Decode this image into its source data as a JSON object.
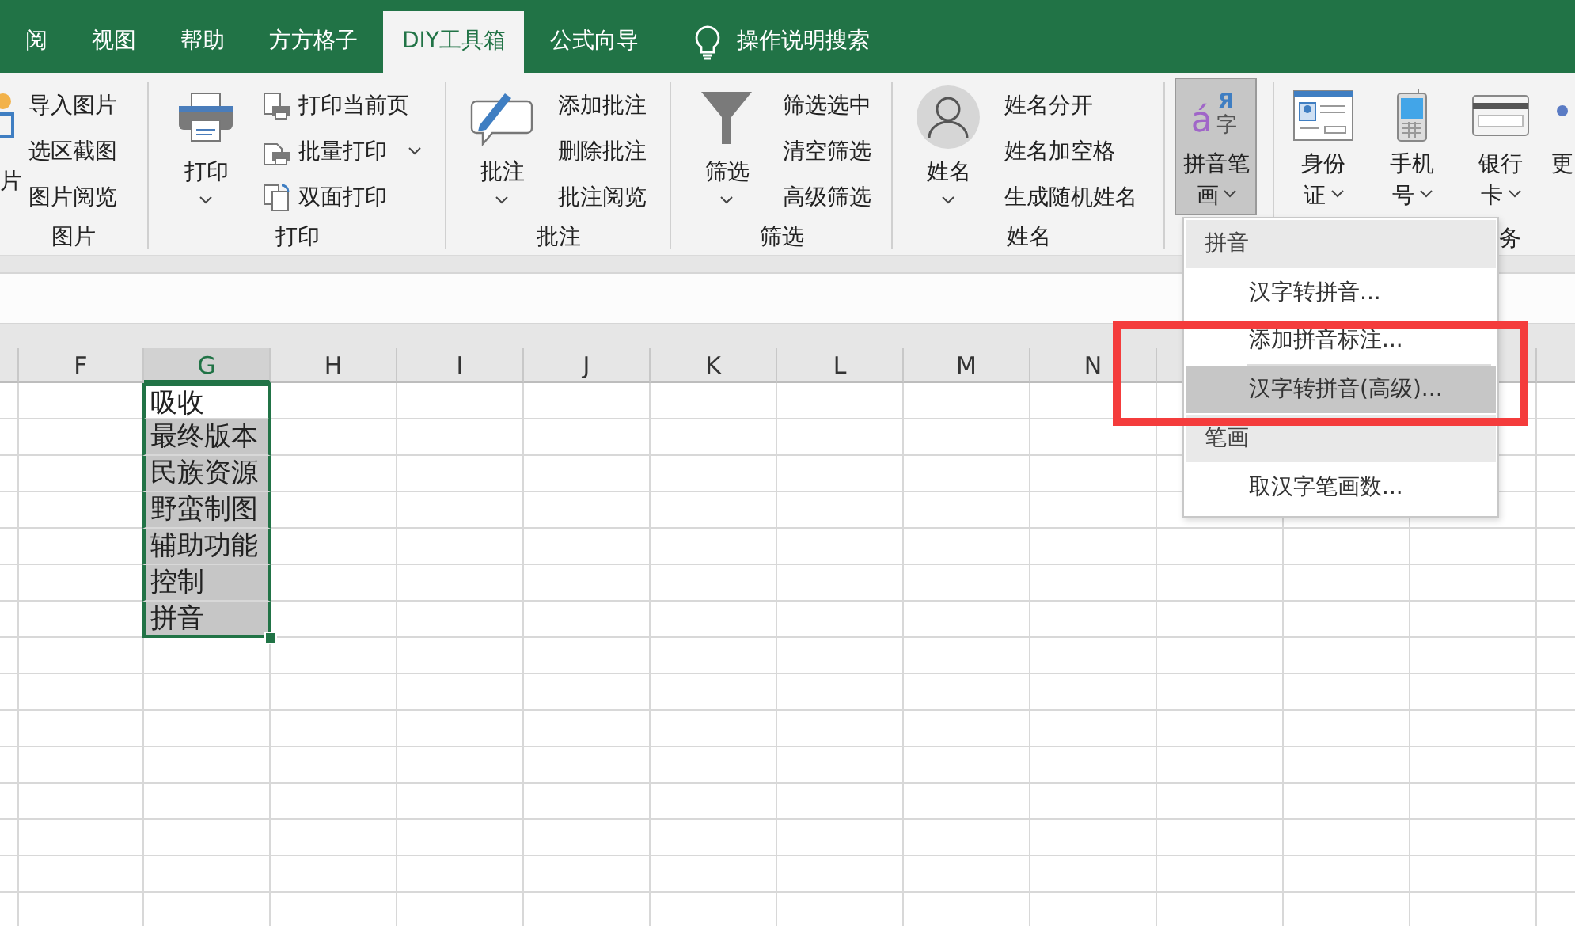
{
  "tabs": [
    {
      "label": "阅",
      "selected": false
    },
    {
      "label": "视图",
      "selected": false
    },
    {
      "label": "帮助",
      "selected": false
    },
    {
      "label": "方方格子",
      "selected": false
    },
    {
      "label": "DIY工具箱",
      "selected": true
    },
    {
      "label": "公式向导",
      "selected": false
    }
  ],
  "tell_me": {
    "label": "操作说明搜索"
  },
  "ribbon_groups": [
    {
      "kind": "list",
      "label": "图片",
      "big": {
        "kind": "picture-cut",
        "label": "片",
        "dropdown": false
      },
      "items": [
        {
          "label": "导入图片",
          "dropdown": false
        },
        {
          "label": "选区截图",
          "dropdown": false
        },
        {
          "label": "图片阅览",
          "dropdown": false
        }
      ]
    },
    {
      "kind": "list",
      "label": "打印",
      "big": {
        "kind": "printer",
        "label": "打印",
        "dropdown": true
      },
      "items": [
        {
          "label": "打印当前页",
          "dropdown": false,
          "kind": "page"
        },
        {
          "label": "批量打印",
          "dropdown": true,
          "kind": "batch"
        },
        {
          "label": "双面打印",
          "dropdown": false,
          "kind": "duplex"
        }
      ]
    },
    {
      "kind": "list",
      "label": "批注",
      "big": {
        "kind": "comment",
        "label": "批注",
        "dropdown": true
      },
      "items": [
        {
          "label": "添加批注",
          "dropdown": false
        },
        {
          "label": "删除批注",
          "dropdown": false
        },
        {
          "label": "批注阅览",
          "dropdown": false
        }
      ]
    },
    {
      "kind": "list",
      "label": "筛选",
      "big": {
        "kind": "filter",
        "label": "筛选",
        "dropdown": true
      },
      "items": [
        {
          "label": "筛选选中",
          "dropdown": false
        },
        {
          "label": "清空筛选",
          "dropdown": false
        },
        {
          "label": "高级筛选",
          "dropdown": false
        }
      ]
    },
    {
      "kind": "list",
      "label": "姓名",
      "big": {
        "kind": "person",
        "label": "姓名",
        "dropdown": true
      },
      "items": [
        {
          "label": "姓名分开",
          "dropdown": false
        },
        {
          "label": "姓名加空格",
          "dropdown": false
        },
        {
          "label": "生成随机姓名",
          "dropdown": false
        }
      ]
    },
    {
      "kind": "menu-button",
      "big": {
        "kind": "pinyin",
        "label": "拼音笔画",
        "dropdown": true,
        "expanded": true,
        "glyphs": [
          "á",
          "Я",
          "字"
        ]
      }
    },
    {
      "kind": "buttons",
      "label": "务",
      "buttons": [
        {
          "kind": "idcard",
          "label": "身份证",
          "dropdown": true
        },
        {
          "kind": "phone",
          "label": "手机号",
          "dropdown": true
        },
        {
          "kind": "bankcard",
          "label": "银行卡",
          "dropdown": true
        },
        {
          "kind": "more",
          "label": "更",
          "dropdown": false
        }
      ]
    }
  ],
  "menu": {
    "sections": [
      {
        "header": "拼音",
        "items": [
          {
            "label": "汉字转拼音...",
            "selected": false
          },
          {
            "label": "添加拼音标注...",
            "selected": false
          },
          {
            "label": "汉字转拼音(高级)...",
            "selected": true
          }
        ]
      },
      {
        "header": "笔画",
        "items": [
          {
            "label": "取汉字笔画数...",
            "selected": false
          }
        ]
      }
    ]
  },
  "sheet": {
    "columns": [
      {
        "label": "F",
        "selected": false
      },
      {
        "label": "G",
        "selected": true
      },
      {
        "label": "H",
        "selected": false
      },
      {
        "label": "I",
        "selected": false
      },
      {
        "label": "J",
        "selected": false
      },
      {
        "label": "K",
        "selected": false
      },
      {
        "label": "L",
        "selected": false
      },
      {
        "label": "M",
        "selected": false
      },
      {
        "label": "N",
        "selected": false
      }
    ],
    "cells": [
      {
        "text": "吸收",
        "highlighted": false
      },
      {
        "text": "最终版本",
        "highlighted": true
      },
      {
        "text": "民族资源",
        "highlighted": true
      },
      {
        "text": "野蛮制图",
        "highlighted": true
      },
      {
        "text": "辅助功能",
        "highlighted": true
      },
      {
        "text": "控制",
        "highlighted": true
      },
      {
        "text": "拼音",
        "highlighted": true
      }
    ]
  }
}
